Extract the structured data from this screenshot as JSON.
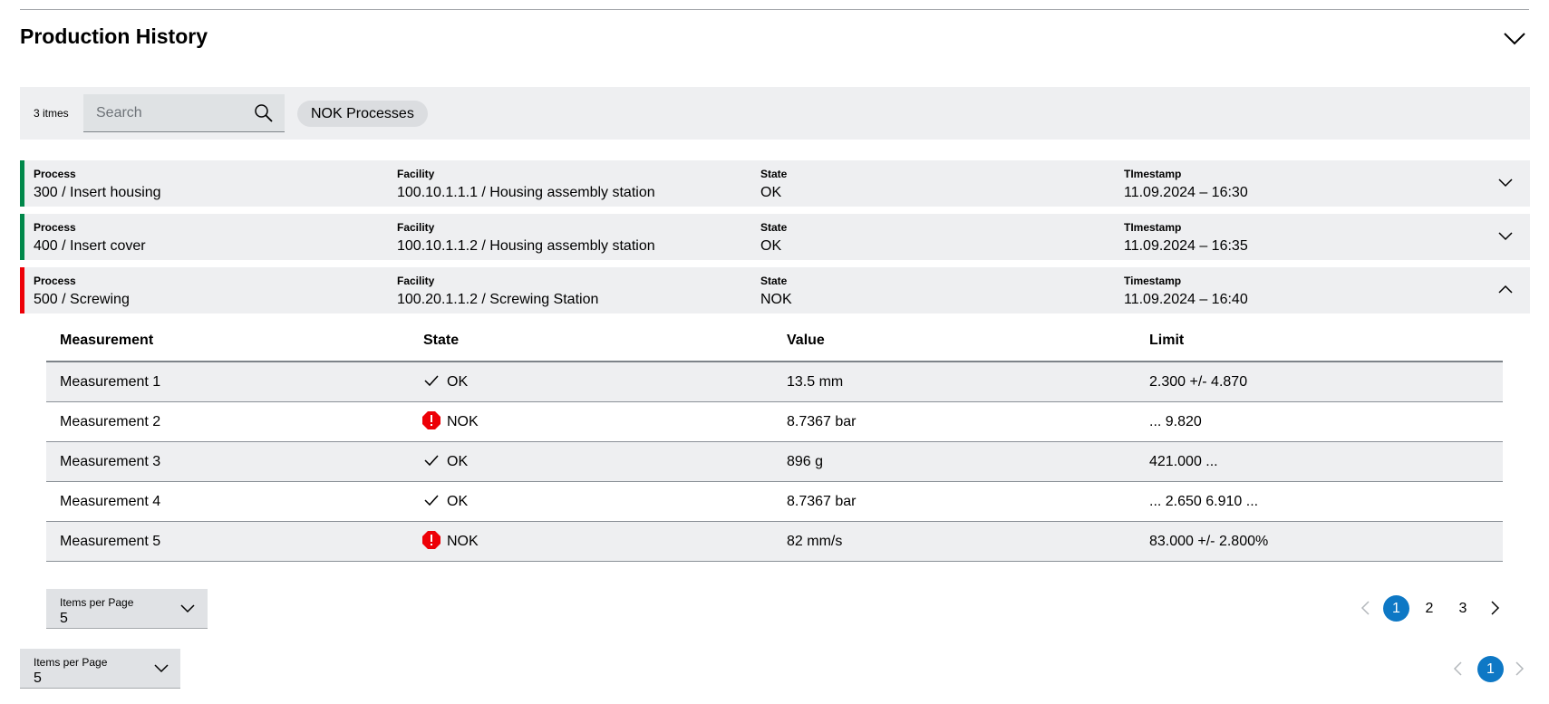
{
  "section": {
    "title": "Production History"
  },
  "toolbar": {
    "count_text": "3 itmes",
    "search_placeholder": "Search",
    "chip_label": "NOK Processes"
  },
  "processes": [
    {
      "process_label": "Process",
      "process": "300 / Insert housing",
      "facility_label": "Facility",
      "facility": "100.10.1.1.1 / Housing assembly station",
      "state_label": "State",
      "state": "OK",
      "timestamp_label": "TImestamp",
      "timestamp": "11.09.2024 – 16:30",
      "status_color": "#00884a",
      "expanded": false
    },
    {
      "process_label": "Process",
      "process": "400 / Insert cover",
      "facility_label": "Facility",
      "facility": "100.10.1.1.2 / Housing assembly station",
      "state_label": "State",
      "state": "OK",
      "timestamp_label": "TImestamp",
      "timestamp": "11.09.2024 – 16:35",
      "status_color": "#00884a",
      "expanded": false
    },
    {
      "process_label": "Process",
      "process": "500 / Screwing",
      "facility_label": "Facility",
      "facility": "100.20.1.1.2 / Screwing Station",
      "state_label": "State",
      "state": "NOK",
      "timestamp_label": "Timestamp",
      "timestamp": "11.09.2024 – 16:40",
      "status_color": "#ed0007",
      "expanded": true
    }
  ],
  "measurements": {
    "headers": [
      "Measurement",
      "State",
      "Value",
      "Limit"
    ],
    "rows": [
      {
        "name": "Measurement 1",
        "state": "OK",
        "state_icon": "check-icon",
        "value": "13.5 mm",
        "limit": "2.300 +/- 4.870"
      },
      {
        "name": "Measurement 2",
        "state": "NOK",
        "state_icon": "alert-icon",
        "value": "8.7367 bar",
        "limit": "... 9.820"
      },
      {
        "name": "Measurement 3",
        "state": "OK",
        "state_icon": "check-icon",
        "value": "896 g",
        "limit": "421.000 ..."
      },
      {
        "name": "Measurement 4",
        "state": "OK",
        "state_icon": "check-icon",
        "value": "8.7367 bar",
        "limit": "... 2.650 6.910 ..."
      },
      {
        "name": "Measurement 5",
        "state": "NOK",
        "state_icon": "alert-icon",
        "value": "82 mm/s",
        "limit": "83.000 +/- 2.800%"
      }
    ]
  },
  "inner_pagination": {
    "items_label": "Items per Page",
    "items_value": "5",
    "pages": [
      "1",
      "2",
      "3"
    ],
    "current": "1"
  },
  "outer_pagination": {
    "items_label": "Items per Page",
    "items_value": "5",
    "pages": [
      "1"
    ],
    "current": "1"
  },
  "colors": {
    "accent": "#0e78c5",
    "ok": "#00884a",
    "nok": "#ed0007"
  }
}
